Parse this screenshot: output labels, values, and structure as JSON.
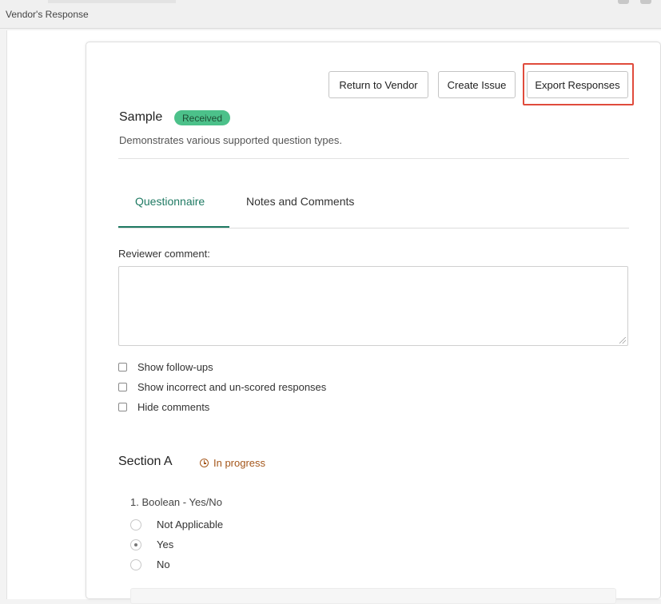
{
  "window": {
    "title": "Vendor's Response"
  },
  "toolbar": {
    "return_label": "Return to Vendor",
    "create_issue_label": "Create Issue",
    "export_label": "Export Responses"
  },
  "header": {
    "title": "Sample",
    "badge": "Received",
    "description": "Demonstrates various supported question types."
  },
  "tabs": [
    {
      "label": "Questionnaire",
      "active": true
    },
    {
      "label": "Notes and Comments",
      "active": false
    }
  ],
  "reviewer": {
    "label": "Reviewer comment:",
    "value": ""
  },
  "options": [
    {
      "label": "Show follow-ups",
      "checked": false
    },
    {
      "label": "Show incorrect and un-scored responses",
      "checked": false
    },
    {
      "label": "Hide comments",
      "checked": false
    }
  ],
  "section": {
    "title": "Section A",
    "status": "In progress",
    "question": {
      "text": "1. Boolean - Yes/No",
      "choices": [
        {
          "label": "Not Applicable",
          "selected": false
        },
        {
          "label": "Yes",
          "selected": true
        },
        {
          "label": "No",
          "selected": false
        }
      ]
    }
  },
  "colors": {
    "accent": "#1f7a63",
    "badge_bg": "#4cc18a",
    "status": "#a4561a",
    "highlight": "#e04b3c"
  }
}
